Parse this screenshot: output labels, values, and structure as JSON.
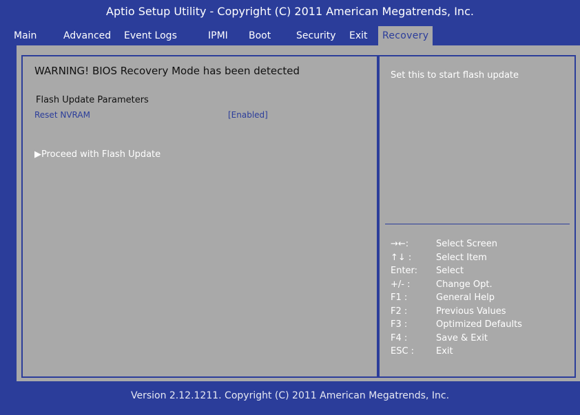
{
  "title": "Aptio Setup Utility - Copyright (C) 2011 American Megatrends, Inc.",
  "menu": [
    {
      "label": "Main"
    },
    {
      "label": "Advanced"
    },
    {
      "label": "Event Logs"
    },
    {
      "label": "IPMI"
    },
    {
      "label": "Boot"
    },
    {
      "label": "Security"
    },
    {
      "label": "Exit"
    },
    {
      "label": "Recovery",
      "active": true
    }
  ],
  "main": {
    "warning": "WARNING! BIOS Recovery Mode has been detected",
    "section_title": "Flash Update Parameters",
    "reset_nvram_label": "Reset NVRAM",
    "reset_nvram_value": "[Enabled]",
    "proceed_label": "Proceed with Flash Update",
    "proceed_arrow": "▶"
  },
  "help": {
    "text": "Set this to start flash update"
  },
  "keys": [
    {
      "key": "→←:",
      "desc": "Select Screen"
    },
    {
      "key": "↑↓ :",
      "desc": "Select Item"
    },
    {
      "key": "Enter:",
      "desc": "Select"
    },
    {
      "key": "+/- :",
      "desc": "Change Opt."
    },
    {
      "key": "F1 :",
      "desc": "General Help"
    },
    {
      "key": "F2 :",
      "desc": "Previous Values"
    },
    {
      "key": "F3 :",
      "desc": "Optimized Defaults"
    },
    {
      "key": "F4 :",
      "desc": "Save & Exit"
    },
    {
      "key": "ESC :",
      "desc": "Exit"
    }
  ],
  "footer": "Version 2.12.1211. Copyright (C) 2011 American Megatrends, Inc.",
  "colors": {
    "background": "#2b3d9a",
    "panel": "#a9a9a9",
    "highlight_text": "#ffffff",
    "setting_text": "#2b3d9a"
  }
}
